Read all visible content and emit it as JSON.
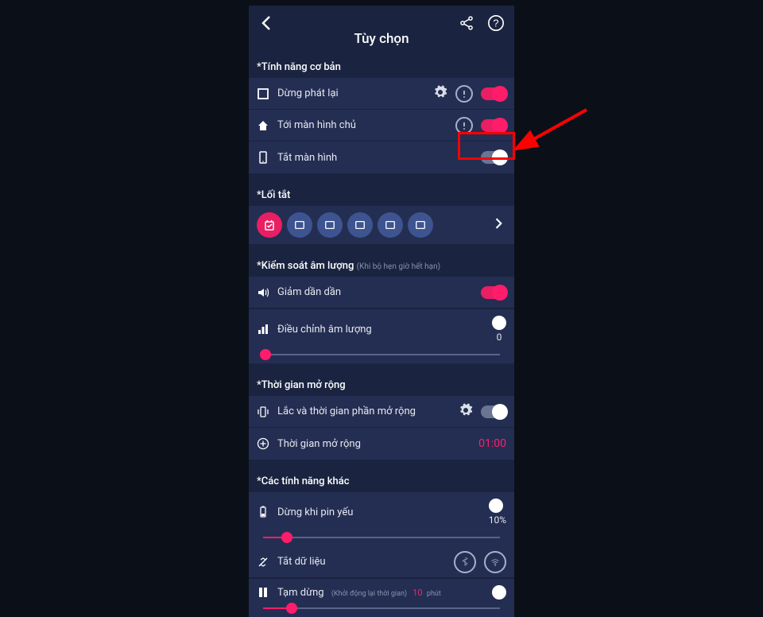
{
  "header": {
    "title": "Tùy chọn"
  },
  "basic": {
    "title": "*Tính năng cơ bản",
    "stop_playback": "Dừng phát lại",
    "home": "Tới màn hình chủ",
    "screen_off": "Tắt màn hình"
  },
  "shortcut": {
    "title": "*Lối tắt"
  },
  "volume": {
    "title": "*Kiểm soát âm lượng",
    "subtitle": "(Khi bộ hẹn giờ hết hạn)",
    "fade": "Giảm dần dần",
    "adjust": "Điều chỉnh âm lượng",
    "value": "0"
  },
  "extend": {
    "title": "*Thời gian mở rộng",
    "shake": "Lắc và thời gian phần mở rộng",
    "time_label": "Thời gian mở rộng",
    "time_value": "01:00"
  },
  "other": {
    "title": "*Các tính năng khác",
    "low_batt": "Dừng khi pin yếu",
    "low_batt_val": "10%",
    "data_off": "Tắt dữ liệu",
    "pause": "Tạm dừng",
    "pause_sub": "(Khởi động lại thời gian)",
    "pause_val": "10",
    "pause_unit": "phút"
  }
}
